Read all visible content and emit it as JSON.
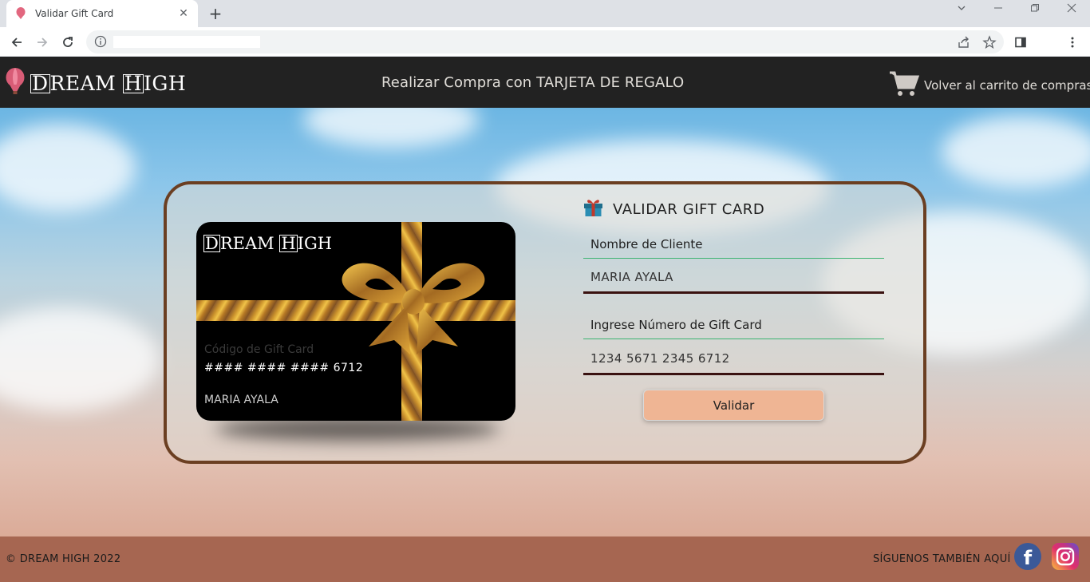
{
  "browser": {
    "tab_title": "Validar Gift Card",
    "new_tab": "+",
    "close": "✕"
  },
  "header": {
    "logo_text_pre": "D",
    "logo_text_mid": "REAM ",
    "logo_text_h": "H",
    "logo_text_post": "IGH",
    "title": "Realizar Compra con TARJETA DE REGALO",
    "cart_label": "Volver al carrito de compras"
  },
  "card": {
    "logo_d": "D",
    "logo_mid": "REAM ",
    "logo_h": "H",
    "logo_post": "IGH",
    "code_label": "Código de Gift Card",
    "number": "#### #### #### 6712",
    "holder": "MARIA AYALA"
  },
  "form": {
    "title": "VALIDAR GIFT CARD",
    "client_label": "Nombre de Cliente",
    "client_value": "MARIA AYALA",
    "card_label": "Ingrese Número de Gift Card",
    "card_value": "1234 5671 2345 6712",
    "validate_button": "Validar"
  },
  "footer": {
    "copyright": "© DREAM HIGH 2022",
    "follow": "SÍGUENOS TAMBIÉN AQUÍ",
    "facebook": "f"
  },
  "colors": {
    "header_bg": "#222222",
    "footer_bg": "#a66651",
    "panel_border": "#6b3f22",
    "button_bg": "#efb594"
  },
  "icons": [
    "balloon-icon",
    "cart-icon",
    "gift-icon",
    "facebook-icon",
    "instagram-icon"
  ]
}
